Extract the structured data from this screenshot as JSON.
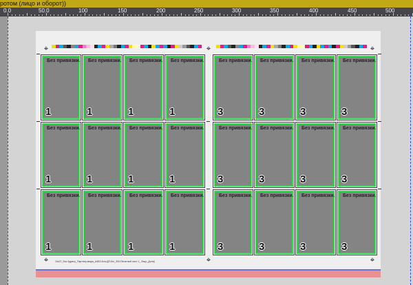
{
  "window": {
    "title": "ротом (лицо и оборот))"
  },
  "ruler": {
    "labels": [
      "0.0",
      "50.0",
      "100",
      "150",
      "200",
      "250",
      "300",
      "350",
      "400",
      "450",
      "500"
    ]
  },
  "colors": {
    "title_bar": "#c2a716",
    "ruler": "#45464b",
    "card_fill": "#848484",
    "card_border": "#22e040",
    "guide": "#1a4fe0",
    "bleed_strip": "#e99191"
  },
  "sheet": {
    "left_block": {
      "label": "Без привязки...",
      "number": "1",
      "rows": 3,
      "cols": 4
    },
    "right_block": {
      "label": "Без привязки...",
      "number": "3",
      "rows": 3,
      "cols": 4
    },
    "footer_text": "10x27_Без Адресу_Партнер-медіа_А4БЗ-Бла-ДП-Кіл_300-Печатный лист 1_ Лицо_Доля]"
  }
}
